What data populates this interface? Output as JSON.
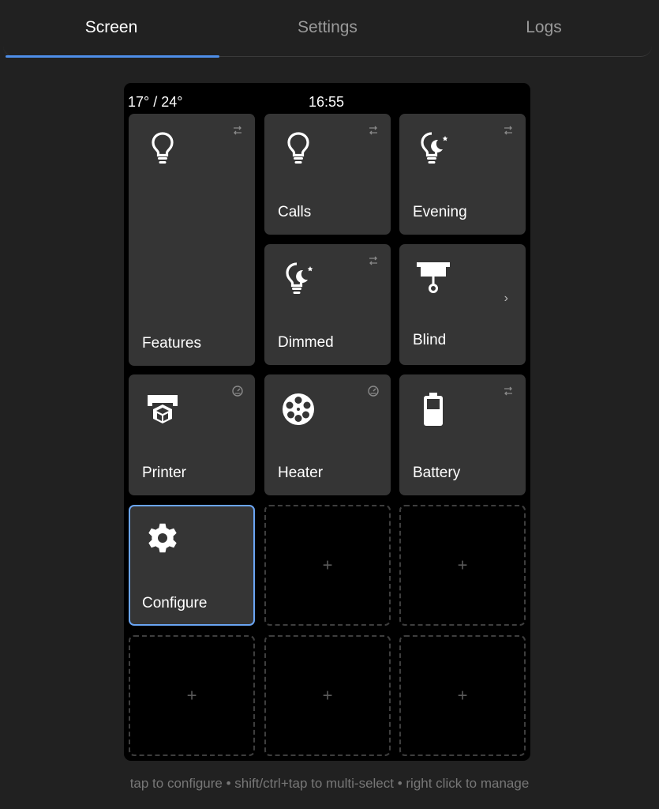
{
  "tabs": [
    {
      "label": "Screen",
      "active": true
    },
    {
      "label": "Settings",
      "active": false
    },
    {
      "label": "Logs",
      "active": false
    }
  ],
  "status_bar": {
    "temperature": "17° / 24°",
    "time": "16:55"
  },
  "tiles": [
    {
      "label": "Features",
      "icon": "lightbulb-icon",
      "badge": "swap-icon"
    },
    {
      "label": "Calls",
      "icon": "lightbulb-icon",
      "badge": "swap-icon"
    },
    {
      "label": "Evening",
      "icon": "night-light-icon",
      "badge": "swap-icon"
    },
    {
      "label": "Dimmed",
      "icon": "night-light-icon",
      "badge": "swap-icon"
    },
    {
      "label": "Blind",
      "icon": "blind-icon",
      "badge": "chevron-right-icon",
      "chevron": "›"
    },
    {
      "label": "Printer",
      "icon": "printer-3d-icon",
      "badge": "gauge-icon"
    },
    {
      "label": "Heater",
      "icon": "film-reel-icon",
      "badge": "gauge-icon"
    },
    {
      "label": "Battery",
      "icon": "battery-icon",
      "badge": "swap-icon"
    },
    {
      "label": "Configure",
      "icon": "gear-icon",
      "selected": true
    }
  ],
  "empty_slot_symbol": "+",
  "hint": "tap to configure • shift/ctrl+tap to multi-select • right click to manage",
  "colors": {
    "background": "#212121",
    "screen": "#000000",
    "tile": "#353535",
    "accent": "#4e8ee8",
    "selected_border": "#6aa4f2"
  }
}
